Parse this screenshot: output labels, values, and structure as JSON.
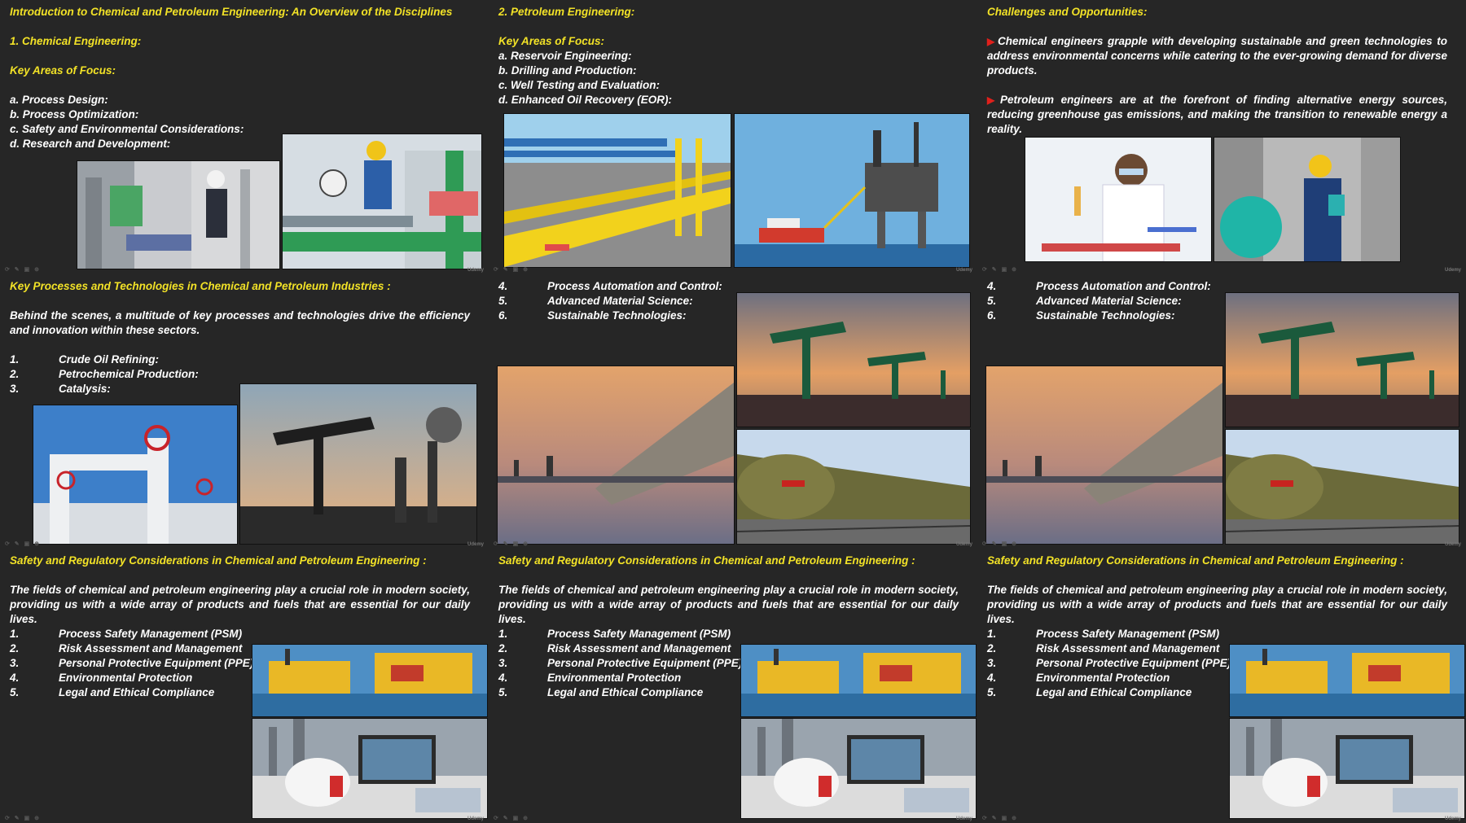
{
  "slides": {
    "s1": {
      "title": "Introduction to Chemical and Petroleum Engineering: An Overview of the Disciplines",
      "heading": "1.   Chemical Engineering:",
      "subheading": "Key Areas of Focus:",
      "items": [
        "a. Process Design:",
        "b. Process Optimization:",
        "c. Safety and Environmental Considerations:",
        "d. Research and Development:"
      ],
      "watermark": "Udemy"
    },
    "s2": {
      "title": "2. Petroleum Engineering:",
      "subheading": "Key Areas of Focus:",
      "items": [
        "a. Reservoir Engineering:",
        "b. Drilling and Production:",
        "c. Well Testing and Evaluation:",
        "d. Enhanced Oil Recovery (EOR):"
      ],
      "watermark": "Udemy"
    },
    "s3": {
      "title": "Challenges and Opportunities:",
      "bullets": [
        "Chemical engineers grapple with developing sustainable and green technologies to address environmental concerns while catering to the ever-growing demand for diverse products.",
        "Petroleum engineers are at the forefront of finding alternative energy sources, reducing greenhouse gas emissions, and making the transition to renewable energy a reality."
      ],
      "watermark": "Udemy"
    },
    "s4": {
      "title": "Key Processes and Technologies in Chemical and Petroleum Industries :",
      "intro": "Behind the scenes, a multitude of key processes and technologies drive the efficiency and innovation within these sectors.",
      "numbers": [
        "1.",
        "2.",
        "3."
      ],
      "items": [
        "Crude Oil Refining:",
        "Petrochemical Production:",
        "Catalysis:"
      ],
      "watermark": "Udemy"
    },
    "s5": {
      "numbers": [
        "4.",
        "5.",
        "6."
      ],
      "items": [
        "Process Automation and Control:",
        "Advanced Material Science:",
        "Sustainable Technologies:"
      ],
      "watermark": "Udemy"
    },
    "s6": {
      "numbers": [
        "4.",
        "5.",
        "6."
      ],
      "items": [
        "Process Automation and Control:",
        "Advanced Material Science:",
        "Sustainable Technologies:"
      ],
      "watermark": "Udemy"
    },
    "s7": {
      "title": "Safety and Regulatory Considerations in Chemical and Petroleum Engineering :",
      "intro": "The fields of chemical and petroleum engineering play a crucial role in modern society, providing us with a wide array of products and fuels that are essential for our daily lives.",
      "numbers": [
        "1.",
        "2.",
        "3.",
        "4.",
        "5."
      ],
      "items": [
        "Process Safety Management (PSM)",
        "Risk Assessment and Management",
        "Personal Protective Equipment (PPE)",
        "Environmental Protection",
        "Legal and Ethical Compliance"
      ],
      "watermark": "Udemy"
    },
    "s8": {
      "title": "Safety and Regulatory Considerations in Chemical and Petroleum Engineering :",
      "intro": "The fields of chemical and petroleum engineering play a crucial role in modern society, providing us with a wide array of products and fuels that are essential for our daily lives.",
      "numbers": [
        "1.",
        "2.",
        "3.",
        "4.",
        "5."
      ],
      "items": [
        "Process Safety Management (PSM)",
        "Risk Assessment and Management",
        "Personal Protective Equipment (PPE)",
        "Environmental Protection",
        "Legal and Ethical Compliance"
      ],
      "watermark": "Udemy"
    },
    "s9": {
      "title": "Safety and Regulatory Considerations in Chemical and Petroleum Engineering :",
      "intro": "The fields of chemical and petroleum engineering play a crucial role in modern society, providing us with a wide array of products and fuels that are essential for our daily lives.",
      "numbers": [
        "1.",
        "2.",
        "3.",
        "4.",
        "5."
      ],
      "items": [
        "Process Safety Management (PSM)",
        "Risk Assessment and Management",
        "Personal Protective Equipment (PPE)",
        "Environmental Protection",
        "Legal and Ethical Compliance"
      ],
      "watermark": "Udemy"
    }
  },
  "colors": {
    "background": "#262626",
    "accent": "#f2e227",
    "text": "#ffffff",
    "bullet": "#e0201b"
  },
  "footer_icons": "⟳ ✎ ▣ ⊕"
}
